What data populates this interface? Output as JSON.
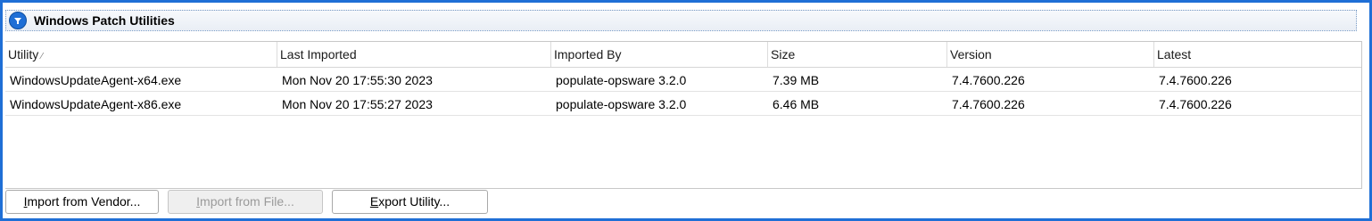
{
  "section": {
    "title": "Windows Patch Utilities",
    "collapse_icon": "chevron-down-in-circle-icon"
  },
  "table": {
    "columns": [
      {
        "label": "Utility",
        "sort": "ascending"
      },
      {
        "label": "Last Imported"
      },
      {
        "label": "Imported By"
      },
      {
        "label": "Size"
      },
      {
        "label": "Version"
      },
      {
        "label": "Latest"
      }
    ],
    "sort_indicator": "⁄",
    "rows": [
      {
        "utility": "WindowsUpdateAgent-x64.exe",
        "last_imported": "Mon Nov 20 17:55:30 2023",
        "imported_by": "populate-opsware 3.2.0",
        "size": "7.39 MB",
        "version": "7.4.7600.226",
        "latest": "7.4.7600.226"
      },
      {
        "utility": "WindowsUpdateAgent-x86.exe",
        "last_imported": "Mon Nov 20 17:55:27 2023",
        "imported_by": "populate-opsware 3.2.0",
        "size": "6.46 MB",
        "version": "7.4.7600.226",
        "latest": "7.4.7600.226"
      }
    ]
  },
  "buttons": {
    "import_vendor": {
      "mnemonic": "I",
      "rest": "mport from Vendor...",
      "enabled": true
    },
    "import_file": {
      "mnemonic": "I",
      "rest": "mport from File...",
      "enabled": false
    },
    "export_utility": {
      "mnemonic": "E",
      "rest": "xport Utility...",
      "enabled": true
    }
  },
  "colors": {
    "accent": "#1f6fd6",
    "disabled_text": "#9a9a9a"
  }
}
